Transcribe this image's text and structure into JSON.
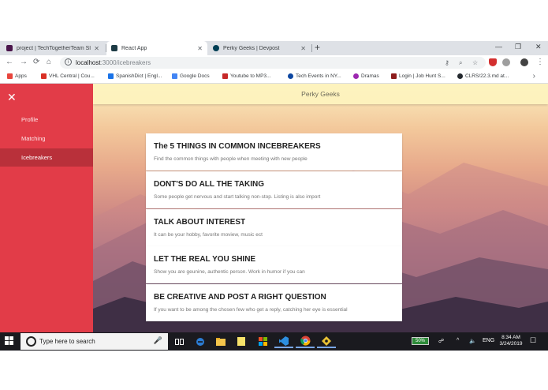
{
  "browser": {
    "tabs": [
      {
        "title": "project | TechTogetherTeam Slack",
        "close": "✕",
        "favicon_color": "#4a154b",
        "active": false
      },
      {
        "title": "React App",
        "close": "✕",
        "favicon_color": "#1d3b45",
        "active": true
      },
      {
        "title": "Perky Geeks | Devpost",
        "close": "✕",
        "favicon_color": "#003e54",
        "active": false
      }
    ],
    "new_tab": "+",
    "window_controls": {
      "minimize": "—",
      "maximize": "❐",
      "close": "✕"
    },
    "nav": {
      "back": "←",
      "forward": "→",
      "reload": "⟳",
      "home": "⌂"
    },
    "url_host": "localhost",
    "url_path": ":3000/icebreakers",
    "omnibox_icons": {
      "key": "⚷",
      "zoom": "⌕",
      "star": "☆"
    },
    "menu": "⋮",
    "bookmarks": [
      {
        "label": "Apps",
        "color": "#e8453c"
      },
      {
        "label": "VHL Central | Cou...",
        "color": "#d93025"
      },
      {
        "label": "SpanishDict | Engl...",
        "color": "#1a73e8"
      },
      {
        "label": "Google Docs",
        "color": "#4285f4"
      },
      {
        "label": "Youtube to MP3...",
        "color": "#c62828"
      },
      {
        "label": "Tech Events in NY...",
        "color": "#0d47a1"
      },
      {
        "label": "Dramas",
        "color": "#9c27b0"
      },
      {
        "label": "Login | Job Hunt S...",
        "color": "#8d1c1c"
      },
      {
        "label": "CLRS/22.3.md at...",
        "color": "#24292e"
      }
    ],
    "bookmarks_more": "›"
  },
  "app": {
    "title": "Perky Geeks",
    "close_icon": "✕",
    "sidebar": [
      {
        "label": "Profile",
        "active": false
      },
      {
        "label": "Matching",
        "active": false
      },
      {
        "label": "Icebreakers",
        "active": true
      }
    ],
    "cards": [
      {
        "title": "The 5 THINGS IN COMMON INCEBREAKERS",
        "subtitle": "Find the common things with people when meeting with new people"
      },
      {
        "title": "DONT'S DO ALL THE TAKING",
        "subtitle": "Some people get nervous and start talking non-stop. Listing is also import"
      },
      {
        "title": "TALK ABOUT INTEREST",
        "subtitle": "It can be your hobby, favorite moview, music ect"
      },
      {
        "title": "LET THE REAL YOU SHINE",
        "subtitle": "Show you are geunine, authentic person. Work in humor if you can"
      },
      {
        "title": "BE CREATIVE AND POST A RIGHT QUESTION",
        "subtitle": "If you want to be among the chosen few who get a reply, catching her eye is essential"
      }
    ],
    "colors": {
      "sidebar": "#e23c48",
      "sidebar_active": "#b9303a",
      "appbar": "#fdf3be"
    }
  },
  "taskbar": {
    "search_placeholder": "Type here to search",
    "mic_icon": "🎤",
    "battery": "50%",
    "tray": {
      "chevron": "^",
      "people": "☍",
      "volume": "🔈",
      "language": "ENG"
    },
    "time": "8:34 AM",
    "date": "3/24/2019",
    "notification_icon": "☐"
  }
}
